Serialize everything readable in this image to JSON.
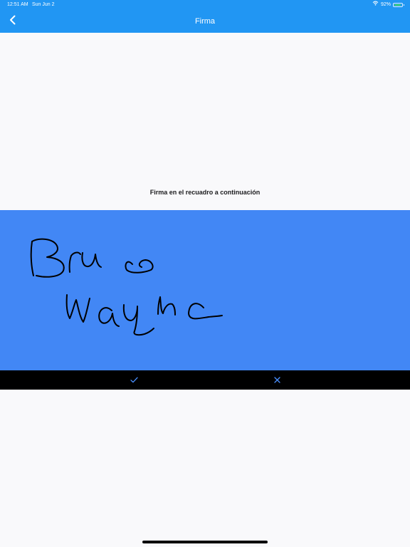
{
  "status_bar": {
    "time": "12:51 AM",
    "date": "Sun Jun 2",
    "battery_text": "92%",
    "battery_level": 0.92,
    "wifi_icon": "wifi-icon"
  },
  "nav": {
    "title": "Firma",
    "back_icon": "chevron-left-icon"
  },
  "instruction": "Firma en el recuadro a continuación",
  "signature_pad": {
    "signature_content": "handwritten signature",
    "pad_color": "#4287f5"
  },
  "actions": {
    "confirm_icon": "check-icon",
    "clear_icon": "close-icon"
  },
  "colors": {
    "header": "#2196f3",
    "accent": "#4a90ff",
    "action_bar": "#000000"
  }
}
